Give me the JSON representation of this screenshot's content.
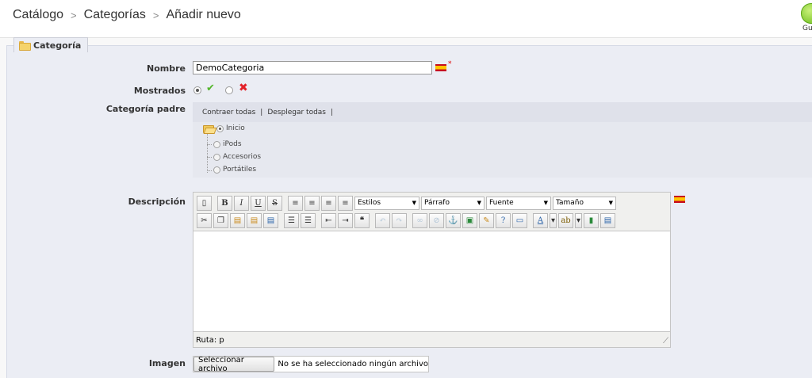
{
  "breadcrumb": {
    "items": [
      "Catálogo",
      "Categorías",
      "Añadir nuevo"
    ],
    "separator": ">"
  },
  "save": {
    "label": "Gu"
  },
  "legend": {
    "label": "Categoría"
  },
  "form": {
    "name": {
      "label": "Nombre",
      "value": "DemoCategoria",
      "required_mark": "*"
    },
    "shown": {
      "label": "Mostrados",
      "selected": "yes"
    },
    "parent": {
      "label": "Categoría padre",
      "collapse_label": "Contraer todas",
      "expand_label": "Desplegar todas",
      "separator": "|",
      "tree": [
        {
          "label": "Inicio",
          "checked": true
        },
        {
          "label": "iPods",
          "checked": false
        },
        {
          "label": "Accesorios",
          "checked": false
        },
        {
          "label": "Portátiles",
          "checked": false
        }
      ]
    },
    "description": {
      "label": "Descripción",
      "selects": [
        "Estilos",
        "Párrafo",
        "Fuente",
        "Tamaño"
      ],
      "status": "Ruta: p"
    },
    "image": {
      "label": "Imagen",
      "button_label": "Seleccionar archivo",
      "no_file_text": "No se ha seleccionado ningún archivo"
    }
  },
  "colors": {
    "accept": "#52b52a",
    "reject": "#e3222a",
    "panel": "#ebedf4"
  }
}
